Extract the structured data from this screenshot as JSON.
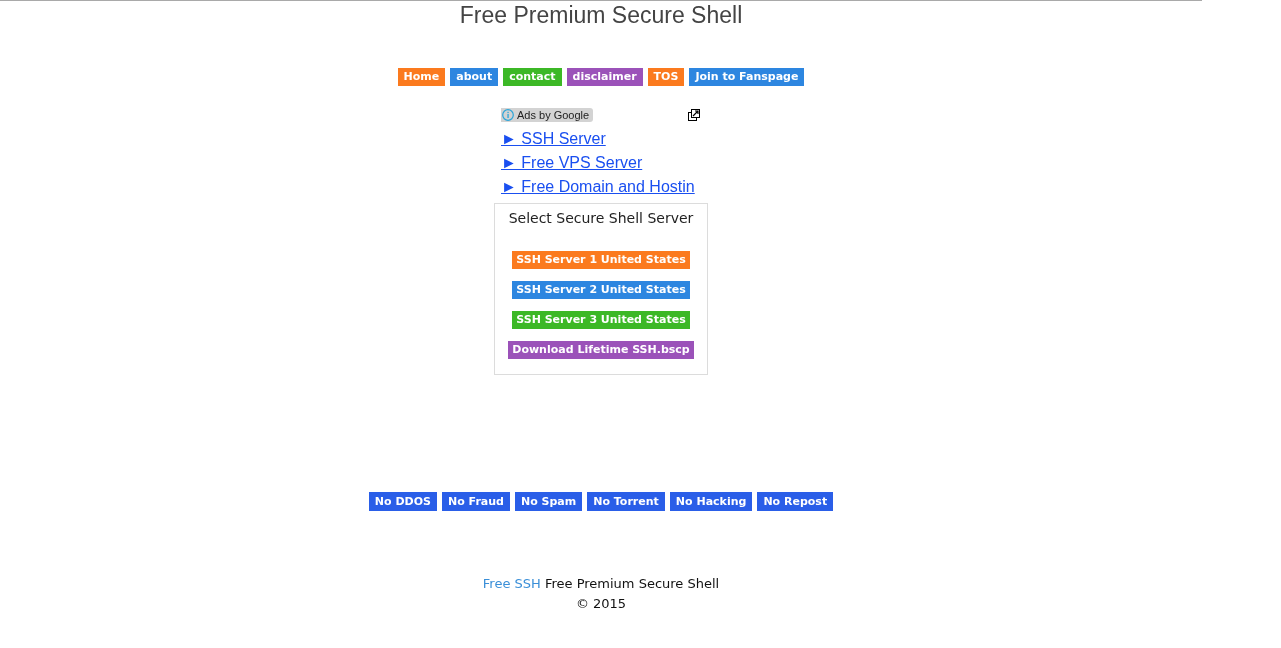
{
  "page": {
    "title": "Free Premium Secure Shell"
  },
  "nav": [
    {
      "label": "Home",
      "color": "#fb7a1e"
    },
    {
      "label": "about",
      "color": "#2d86e0"
    },
    {
      "label": "contact",
      "color": "#3cb826"
    },
    {
      "label": "disclaimer",
      "color": "#9b52b9"
    },
    {
      "label": "TOS",
      "color": "#fb7a1e"
    },
    {
      "label": "Join to Fanspage",
      "color": "#2d86e0"
    }
  ],
  "ads": {
    "badge": "Ads by Google",
    "links": [
      "► SSH Server",
      "► Free VPS Server",
      "► Free Domain and Hostin"
    ]
  },
  "server_panel": {
    "title": "Select Secure Shell Server",
    "buttons": [
      {
        "label": "SSH Server 1 United States",
        "color": "#fb7a1e"
      },
      {
        "label": "SSH Server 2 United States",
        "color": "#2d86e0"
      },
      {
        "label": "SSH Server 3 United States",
        "color": "#3cb826"
      },
      {
        "label": "Download Lifetime SSH.bscp",
        "color": "#9b52b9"
      }
    ]
  },
  "rules": [
    "No DDOS",
    "No Fraud",
    "No Spam",
    "No Torrent",
    "No Hacking",
    "No Repost"
  ],
  "footer": {
    "link": "Free SSH",
    "text": "Free Premium Secure Shell",
    "copyright": "© 2015"
  }
}
